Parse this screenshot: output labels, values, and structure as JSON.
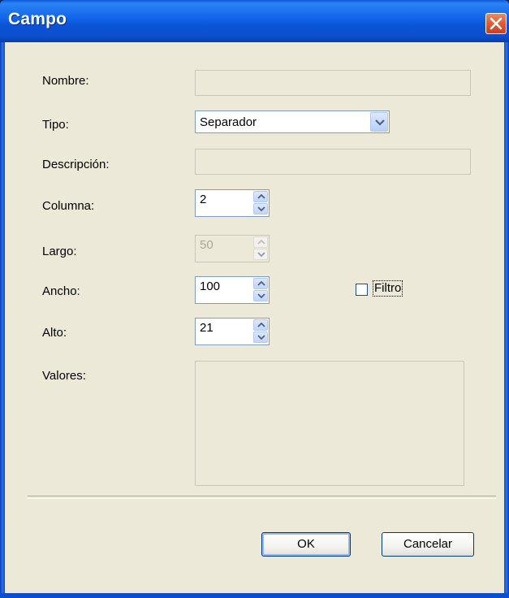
{
  "window": {
    "title": "Campo"
  },
  "form": {
    "nombre_label": "Nombre:",
    "nombre_value": "",
    "tipo_label": "Tipo:",
    "tipo_value": "Separador",
    "descripcion_label": "Descripción:",
    "descripcion_value": "",
    "columna_label": "Columna:",
    "columna_value": "2",
    "largo_label": "Largo:",
    "largo_value": "50",
    "ancho_label": "Ancho:",
    "ancho_value": "100",
    "alto_label": "Alto:",
    "alto_value": "21",
    "valores_label": "Valores:",
    "valores_value": "",
    "filtro_label": "Filtro",
    "filtro_checked": false
  },
  "buttons": {
    "ok_label": "OK",
    "cancel_label": "Cancelar"
  },
  "colors": {
    "titlebar": "#0b54d6",
    "client_bg": "#ece9d8",
    "close_button": "#e0603a"
  }
}
